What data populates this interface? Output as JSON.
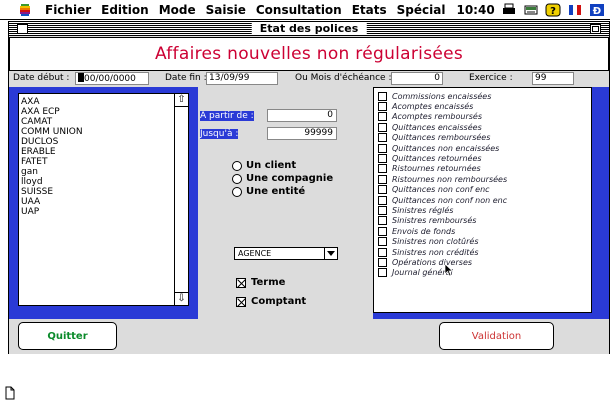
{
  "menubar": {
    "items": [
      "Fichier",
      "Edition",
      "Mode",
      "Saisie",
      "Consultation",
      "Etats",
      "Spécial"
    ],
    "clock": "10:40",
    "icons": [
      "apple-icon",
      "printer-icon",
      "desk-accessory-icon",
      "help-icon",
      "keyboard-flag-icon",
      "application-icon"
    ]
  },
  "window": {
    "title": "Etat des polices",
    "heading": "Affaires nouvelles non régularisées",
    "heading_color": "#cc0033",
    "panel_color": "#2a3ad6"
  },
  "params": {
    "date_debut_label": "Date début :",
    "date_debut_value": "00/00/0000",
    "date_fin_label": "Date fin :",
    "date_fin_value": "13/09/99",
    "mois_label": "Ou Mois d'échéance :",
    "mois_value": "0",
    "exercice_label": "Exercice :",
    "exercice_value": "99"
  },
  "companies": [
    "AXA",
    "AXA ECP",
    "CAMAT",
    "COMM UNION",
    "DUCLOS",
    "ERABLE",
    "FATET",
    "gan",
    "lloyd",
    "SUISSE",
    "UAA",
    "UAP"
  ],
  "range": {
    "from_label": "A partir de :",
    "from_value": "0",
    "to_label": "Jusqu'à :",
    "to_value": "99999"
  },
  "radios": [
    "Un client",
    "Une compagnie",
    "Une entité"
  ],
  "popup": {
    "selected": "AGENCE"
  },
  "checks": [
    {
      "label": "Terme",
      "checked": true
    },
    {
      "label": "Comptant",
      "checked": true
    }
  ],
  "states": [
    "Commissions encaissées",
    "Acomptes encaissés",
    "Acomptes remboursés",
    "Quittances encaissées",
    "Quittances remboursées",
    "Quittances non encaissées",
    "Quittances retournées",
    "Ristournes retournées",
    "Ristournes non remboursées",
    "Quittances non conf enc",
    "Quittances non conf non enc",
    "Sinistres réglés",
    "Sinistres remboursés",
    "Envois de fonds",
    "Sinistres non clotûrés",
    "Sinistres non crédités",
    "Opérations diverses",
    "Journal général"
  ],
  "buttons": {
    "quit": "Quitter",
    "validate": "Validation"
  }
}
